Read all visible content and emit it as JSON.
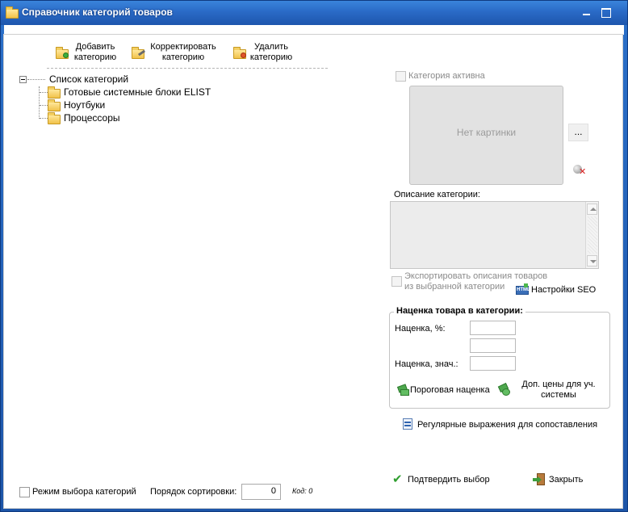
{
  "window": {
    "title": "Справочник категорий товаров"
  },
  "toolbar": {
    "add_line1": "Добавить",
    "add_line2": "категорию",
    "edit_line1": "Корректировать",
    "edit_line2": "категорию",
    "delete_line1": "Удалить",
    "delete_line2": "категорию"
  },
  "tree": {
    "root": "Список категорий",
    "items": [
      {
        "label": "Готовые системные блоки ELIST"
      },
      {
        "label": "Ноутбуки"
      },
      {
        "label": "Процессоры"
      }
    ]
  },
  "details": {
    "active_label": "Категория активна",
    "no_image": "Нет картинки",
    "browse": "...",
    "description_label": "Описание категории:",
    "export_line1": "Экспортировать описания товаров",
    "export_line2": "из выбранной категории",
    "seo_label": "Настройки SEO"
  },
  "markup": {
    "title": "Наценка товара в категории:",
    "percent_label": "Наценка, %:",
    "value_label": "Наценка, знач.:",
    "threshold_label": "Пороговая наценка",
    "extra_line1": "Доп. цены для уч.",
    "extra_line2": "системы"
  },
  "regex_label": "Регулярные выражения для сопоставления",
  "confirm_label": "Подтвердить выбор",
  "close_label": "Закрыть",
  "footer": {
    "mode_label": "Режим выбора категорий",
    "sort_label": "Порядок сортировки:",
    "sort_value": "0",
    "code_label": "Код: 0"
  },
  "colors": {
    "titlebar": "#2a6ac6",
    "folder": "#f1c24a"
  }
}
